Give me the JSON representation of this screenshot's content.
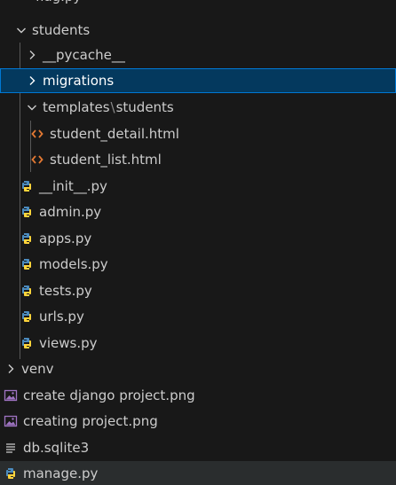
{
  "explorer": {
    "partial_top_label": "flag.py",
    "folders": {
      "students": {
        "label": "students",
        "expanded": true
      },
      "pycache": {
        "label": "__pycache__",
        "expanded": false
      },
      "migrations": {
        "label": "migrations",
        "expanded": false
      },
      "templates": {
        "label_parts": [
          "templates",
          "students"
        ],
        "expanded": true
      },
      "venv": {
        "label": "venv",
        "expanded": false
      }
    },
    "files": {
      "student_detail": {
        "label": "student_detail.html",
        "icon": "html-icon"
      },
      "student_list": {
        "label": "student_list.html",
        "icon": "html-icon"
      },
      "init": {
        "label": "__init__.py",
        "icon": "python-icon"
      },
      "admin": {
        "label": "admin.py",
        "icon": "python-icon"
      },
      "apps": {
        "label": "apps.py",
        "icon": "python-icon"
      },
      "models": {
        "label": "models.py",
        "icon": "python-icon"
      },
      "tests": {
        "label": "tests.py",
        "icon": "python-icon"
      },
      "urls": {
        "label": "urls.py",
        "icon": "python-icon"
      },
      "views": {
        "label": "views.py",
        "icon": "python-icon"
      },
      "create_django": {
        "label": "create django project.png",
        "icon": "image-icon"
      },
      "creating_project": {
        "label": "creating project.png",
        "icon": "image-icon"
      },
      "db": {
        "label": "db.sqlite3",
        "icon": "database-file-icon"
      },
      "manage": {
        "label": "manage.py",
        "icon": "python-icon"
      }
    },
    "colors": {
      "background": "#181818",
      "text": "#cccccc",
      "selected_background": "#04395e",
      "selected_border": "#0078d4",
      "hover_background": "#2a2d2e",
      "html_icon": "#e37933",
      "python_icon_blue": "#4b8bbe",
      "python_icon_yellow": "#ffd43b",
      "image_icon": "#a074c4"
    }
  }
}
